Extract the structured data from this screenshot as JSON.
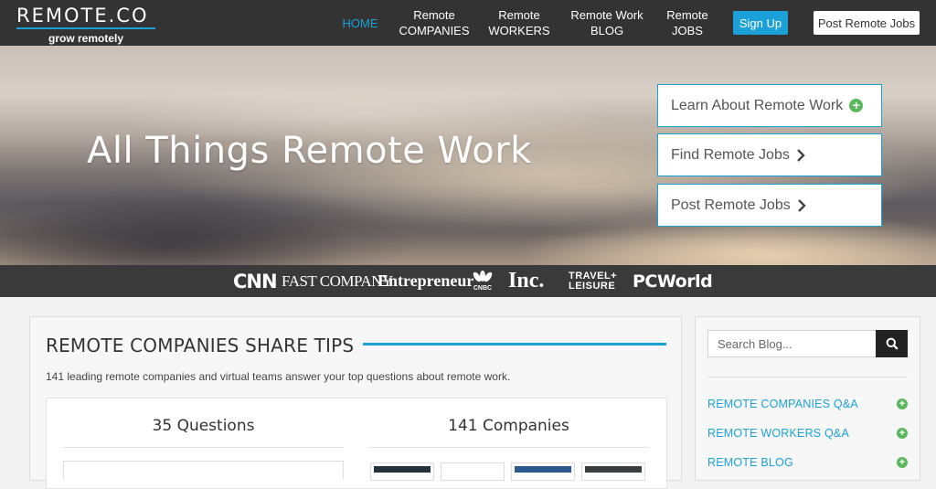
{
  "brand": {
    "name": "REMOTE.CO",
    "tagline": "grow remotely",
    "accent": "#1ba1d8"
  },
  "nav": {
    "items": [
      {
        "line1": "HOME",
        "line2": "",
        "active": true
      },
      {
        "line1": "Remote",
        "line2": "COMPANIES",
        "active": false
      },
      {
        "line1": "Remote",
        "line2": "WORKERS",
        "active": false
      },
      {
        "line1": "Remote Work",
        "line2": "BLOG",
        "active": false
      },
      {
        "line1": "Remote",
        "line2": "JOBS",
        "active": false
      }
    ],
    "signup_label": "Sign Up",
    "post_jobs_label": "Post Remote Jobs"
  },
  "hero": {
    "title": "All Things Remote Work",
    "buttons": [
      {
        "label": "Learn About Remote Work",
        "icon": "plus-circle-icon"
      },
      {
        "label": "Find Remote Jobs",
        "icon": "chevron-right-icon"
      },
      {
        "label": "Post Remote Jobs",
        "icon": "chevron-right-icon"
      }
    ]
  },
  "press": {
    "logos": [
      "CNN",
      "FAST COMPANY",
      "Entrepreneur",
      "CNBC",
      "Inc.",
      "TRAVEL+ LEISURE",
      "PCWorld"
    ]
  },
  "tips": {
    "title": "REMOTE COMPANIES SHARE TIPS",
    "description": "141 leading remote companies and virtual teams answer your top questions about remote work.",
    "stat_questions": "35 Questions",
    "stat_companies": "141 Companies"
  },
  "sidebar": {
    "search_placeholder": "Search Blog...",
    "links": [
      {
        "label": "REMOTE COMPANIES Q&A"
      },
      {
        "label": "REMOTE WORKERS Q&A"
      },
      {
        "label": "REMOTE BLOG"
      }
    ]
  }
}
